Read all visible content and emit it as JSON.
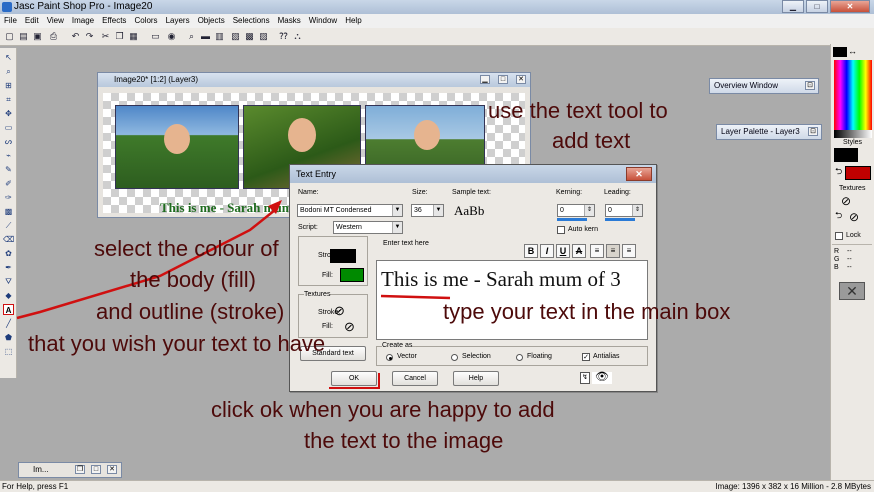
{
  "window": {
    "title": "Jasc Paint Shop Pro - Image20",
    "min_glyph": "▁",
    "max_glyph": "□",
    "close_glyph": "✕"
  },
  "menu": [
    "File",
    "Edit",
    "View",
    "Image",
    "Effects",
    "Colors",
    "Layers",
    "Objects",
    "Selections",
    "Masks",
    "Window",
    "Help"
  ],
  "image_window": {
    "title": "Image20* [1:2] (Layer3)",
    "caption": "This is me - Sarah mum of 3"
  },
  "panels": {
    "overview": "Overview Window",
    "layer_palette": "Layer Palette - Layer3"
  },
  "right_panel": {
    "styles_label": "Styles",
    "textures_label": "Textures",
    "lock_label": "Lock",
    "r_label": "R",
    "g_label": "G",
    "b_label": "B",
    "r_value": "--",
    "g_value": "--",
    "b_value": "--",
    "foreground_color": "#000000",
    "background_color": "#c00000"
  },
  "dialog": {
    "title": "Text Entry",
    "close_glyph": "✕",
    "name_label": "Name:",
    "name_value": "Bodoni MT Condensed",
    "size_label": "Size:",
    "size_value": "36",
    "sample_label": "Sample text:",
    "sample_value": "AaBb",
    "kerning_label": "Kerning:",
    "kerning_value": "0",
    "leading_label": "Leading:",
    "leading_value": "0",
    "script_label": "Script:",
    "script_value": "Western",
    "auto_kern_label": "Auto kern",
    "stroke_label": "Stroke:",
    "fill_label": "Fill:",
    "stroke_color": "#000000",
    "fill_color": "#008a00",
    "textures_label": "Textures",
    "texture_stroke_label": "Stroke:",
    "texture_fill_label": "Fill:",
    "standard_text_label": "Standard text",
    "enter_text_label": "Enter text here",
    "entered_text": "This is me - Sarah mum of 3",
    "bold_glyph": "B",
    "italic_glyph": "I",
    "underline_glyph": "U",
    "strike_glyph": "A",
    "create_as_label": "Create as",
    "vector_label": "Vector",
    "selection_label": "Selection",
    "floating_label": "Floating",
    "antialias_label": "Antialias",
    "ok_label": "OK",
    "cancel_label": "Cancel",
    "help_label": "Help"
  },
  "annotations": {
    "tool_line1": "use the text tool to",
    "tool_line2": "add text",
    "colour_line1": "select the colour of",
    "colour_line2": "the body (fill)",
    "colour_line3": "and outline (stroke)",
    "colour_line4": "that you wish your text to have",
    "type_text": "type your text in the main box",
    "ok_line1": "click ok when you are happy to add",
    "ok_line2": "the text to the image"
  },
  "minimized_window": {
    "title": "Im..."
  },
  "status": {
    "help": "For Help, press F1",
    "image_info": "Image: 1396 x 382 x 16 Million - 2.8 MBytes"
  },
  "colors": {
    "annotation": "#4d0a0a",
    "arrow": "#d01010",
    "caption": "#1f6b1f",
    "workspace": "#ababab"
  }
}
